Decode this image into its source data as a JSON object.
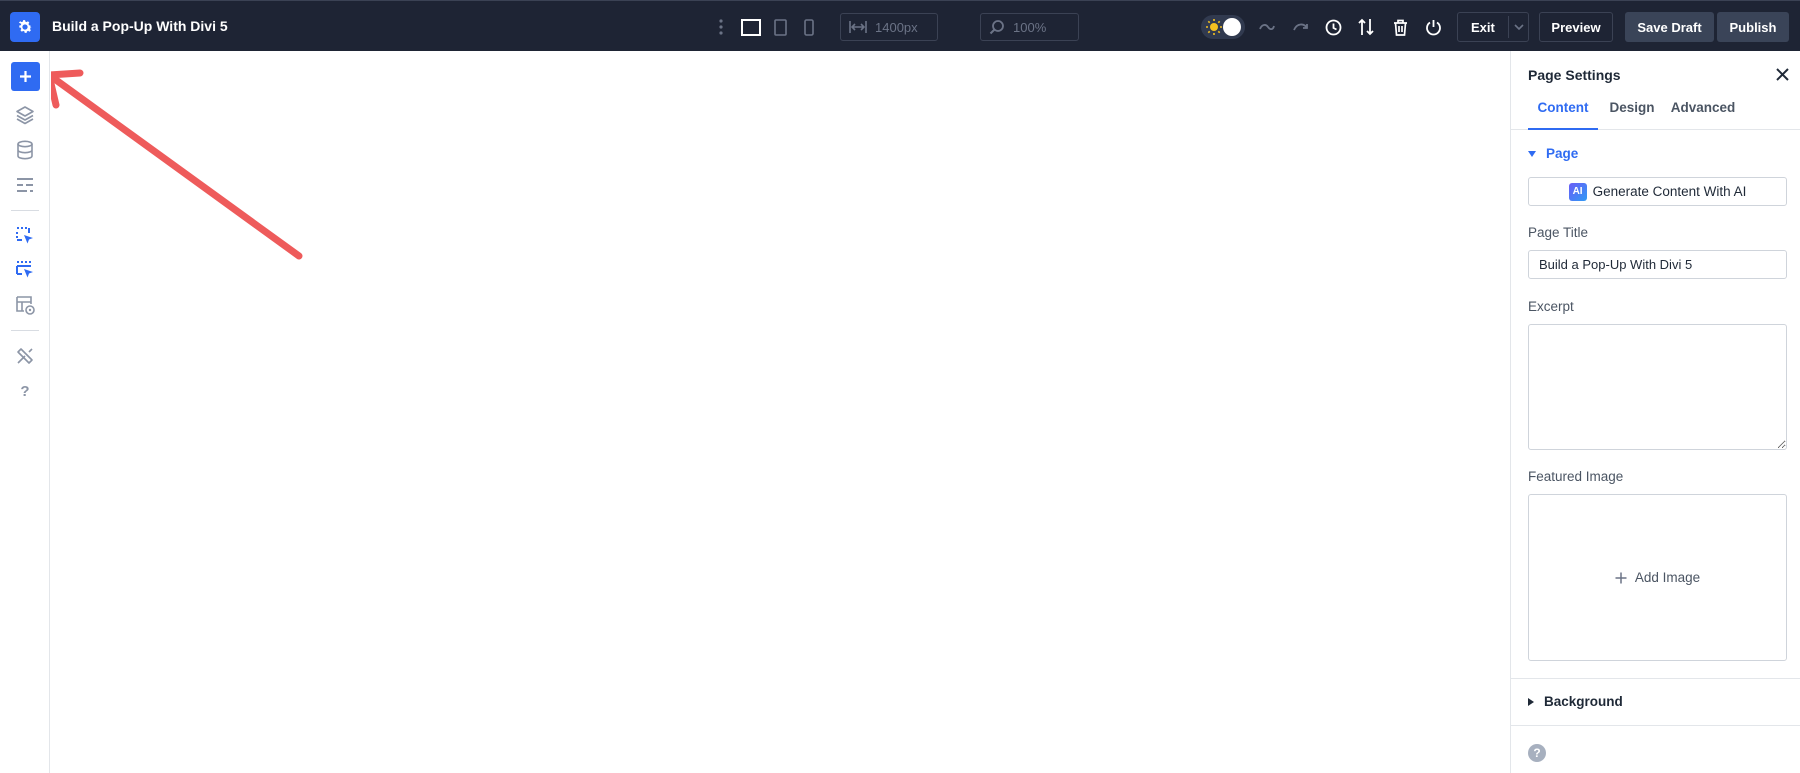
{
  "topbar": {
    "page_title": "Build a Pop-Up With Divi 5",
    "width_value": "1400px",
    "zoom_value": "100%",
    "exit_label": "Exit",
    "preview_label": "Preview",
    "save_draft_label": "Save Draft",
    "publish_label": "Publish",
    "icons": [
      "gear-icon",
      "kebab-menu-icon",
      "desktop-view-icon",
      "tablet-view-icon",
      "phone-view-icon",
      "width-arrows-icon",
      "zoom-icon",
      "sun-icon",
      "undo-icon",
      "redo-icon",
      "history-icon",
      "sort-icon",
      "trash-icon",
      "power-icon",
      "chevron-down-icon"
    ]
  },
  "left_toolbar": {
    "icons": [
      "plus-icon",
      "layers-icon",
      "database-icon",
      "layout-icon",
      "portability-icon",
      "wireframe-icon",
      "preview-layout-icon",
      "tools-icon",
      "help-icon"
    ],
    "help_glyph": "?"
  },
  "panel": {
    "title": "Page Settings",
    "tabs": [
      {
        "label": "Content",
        "active": true
      },
      {
        "label": "Design",
        "active": false
      },
      {
        "label": "Advanced",
        "active": false
      }
    ],
    "section_page": "Page",
    "ai_badge": "AI",
    "ai_button": "Generate Content With AI",
    "page_title_label": "Page Title",
    "page_title_value": "Build a Pop-Up With Divi 5",
    "excerpt_label": "Excerpt",
    "featured_image_label": "Featured Image",
    "add_image_label": "Add Image",
    "section_background": "Background",
    "help_glyph": "?"
  },
  "colors": {
    "topbar_bg": "#1e2434",
    "accent": "#2f6bf2",
    "annotation_arrow": "#ee5b5b"
  }
}
